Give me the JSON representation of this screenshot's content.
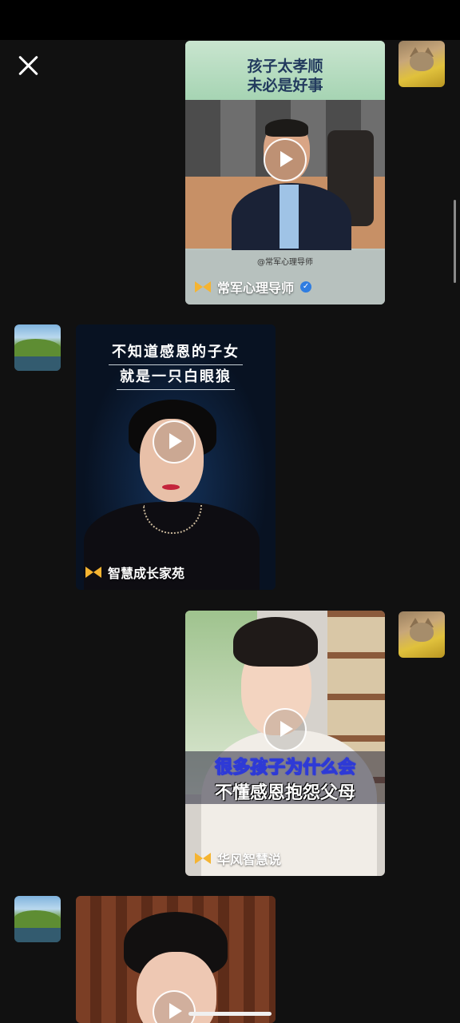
{
  "close_label": "Close",
  "messages": [
    {
      "side": "right",
      "avatar": "cat-avatar",
      "video": {
        "caption_lines": [
          "孩子太孝顺",
          "未必是好事"
        ],
        "watermark": "@常军心理导师",
        "author": "常军心理导师",
        "verified": "✓"
      }
    },
    {
      "side": "left",
      "avatar": "landscape-avatar",
      "video": {
        "caption_lines": [
          "不知道感恩的子女",
          "就是一只白眼狼"
        ],
        "author": "智慧成长家苑"
      }
    },
    {
      "side": "right",
      "avatar": "cat-avatar",
      "video": {
        "caption_lines": [
          "很多孩子为什么会",
          "不懂感恩抱怨父母"
        ],
        "author": "华风智慧说"
      }
    },
    {
      "side": "left",
      "avatar": "landscape-avatar",
      "video": {
        "caption_lines": [],
        "author": ""
      }
    }
  ],
  "colors": {
    "background": "#111111",
    "brand_bowtie": "#f5b431",
    "verified_badge": "#2f7de1"
  },
  "icons": [
    "close-icon",
    "play-icon",
    "bowtie-logo-icon",
    "verified-icon"
  ]
}
